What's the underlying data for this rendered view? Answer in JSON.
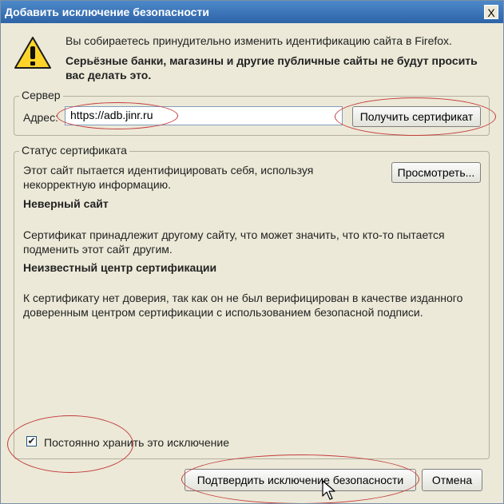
{
  "window": {
    "title": "Добавить исключение безопасности",
    "close_label": "X"
  },
  "intro": {
    "message": "Вы собираетесь принудительно изменить идентификацию сайта в Firefox.",
    "warning": "Серьёзные банки, магазины и другие публичные сайты не будут просить вас делать это."
  },
  "server": {
    "legend": "Сервер",
    "address_label": "Адрес:",
    "address_value": "https://adb.jinr.ru",
    "get_cert_label": "Получить сертификат"
  },
  "status": {
    "legend": "Статус сертификата",
    "summary": "Этот сайт пытается идентифицировать себя, используя некорректную информацию.",
    "view_label": "Просмотреть...",
    "issues": [
      {
        "title": "Неверный сайт",
        "text": "Сертификат принадлежит другому сайту, что может значить, что кто-то пытается подменить этот сайт другим."
      },
      {
        "title": "Неизвестный центр сертификации",
        "text": "К сертификату нет доверия, так как он не был верифицирован в качестве изданного доверенным центром сертификации с использованием безопасной подписи."
      }
    ]
  },
  "permanent": {
    "label": "Постоянно хранить это исключение",
    "checked": true
  },
  "buttons": {
    "confirm_label": "Подтвердить исключение безопасности",
    "cancel_label": "Отмена"
  },
  "icons": {
    "warning": "warning-icon",
    "close": "close-icon",
    "cursor": "mouse-cursor-icon"
  },
  "colors": {
    "titlebar": "#2d64a8",
    "dialog_bg": "#ece9d8",
    "annotation": "#c43b3b"
  }
}
